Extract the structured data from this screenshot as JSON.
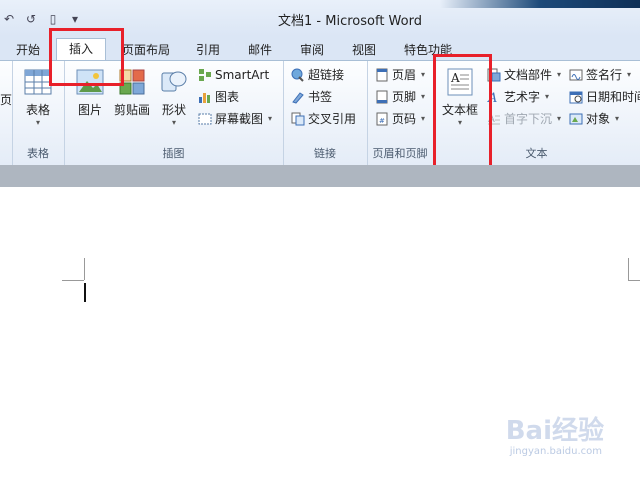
{
  "window": {
    "title": "文档1 - Microsoft Word"
  },
  "quick_access": {
    "undo": "↶",
    "redo": "↺",
    "new": "▯",
    "more": "▾"
  },
  "tabs": [
    {
      "label": "开始"
    },
    {
      "label": "插入"
    },
    {
      "label": "页面布局"
    },
    {
      "label": "引用"
    },
    {
      "label": "邮件"
    },
    {
      "label": "审阅"
    },
    {
      "label": "视图"
    },
    {
      "label": "特色功能"
    }
  ],
  "ribbon": {
    "cut_edge_label": "页",
    "groups": {
      "tables": {
        "label": "表格",
        "table_button": "表格"
      },
      "illustrations": {
        "label": "插图",
        "picture": "图片",
        "clipart": "剪贴画",
        "shapes": "形状",
        "smartart": "SmartArt",
        "chart": "图表",
        "screenshot": "屏幕截图"
      },
      "links": {
        "label": "链接",
        "hyperlink": "超链接",
        "bookmark": "书签",
        "crossref": "交叉引用"
      },
      "header_footer": {
        "label": "页眉和页脚",
        "header": "页眉",
        "footer": "页脚",
        "page_number": "页码"
      },
      "text": {
        "label": "文本",
        "textbox": "文本框",
        "quickparts": "文档部件",
        "wordart": "艺术字",
        "dropcap": "首字下沉",
        "signature": "签名行",
        "datetime": "日期和时间",
        "object": "对象"
      }
    }
  },
  "watermark": {
    "brand": "Bai经验",
    "url": "jingyan.baidu.com"
  },
  "colors": {
    "highlight": "#e8202a",
    "ribbon_border": "#a9bfd6"
  }
}
